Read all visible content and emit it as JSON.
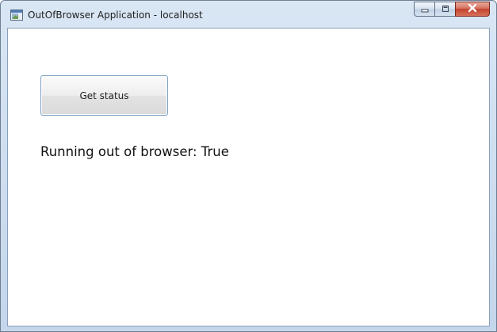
{
  "window": {
    "title": "OutOfBrowser Application - localhost",
    "icon": "app-window-icon",
    "controls": {
      "minimize_icon": "minimize-icon",
      "maximize_icon": "maximize-icon",
      "close_icon": "close-icon"
    },
    "colors": {
      "close_button": "#c7432c",
      "frame": "#c8d8ec"
    }
  },
  "content": {
    "get_status_label": "Get status",
    "status_text": "Running out of browser: True"
  }
}
